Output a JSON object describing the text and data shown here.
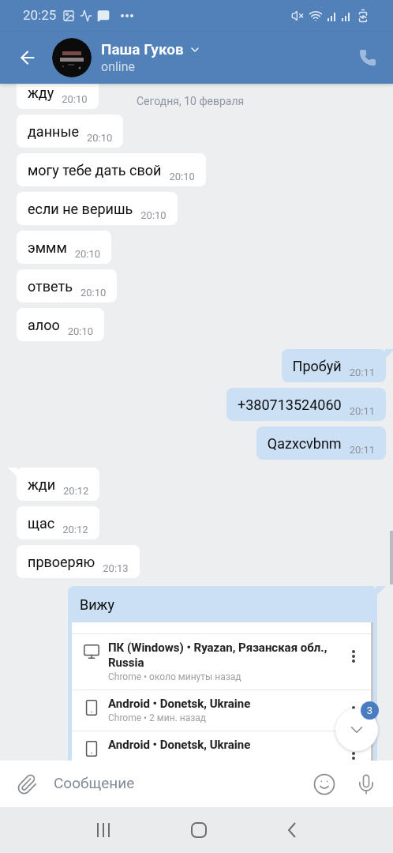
{
  "status_bar": {
    "time": "20:25"
  },
  "header": {
    "name": "Паша Гуков",
    "status": "online"
  },
  "date_label": "Сегодня, 10 февраля",
  "messages": [
    {
      "kind": "incoming",
      "text": "жду",
      "time": "20:10"
    },
    {
      "kind": "incoming",
      "text": "данные",
      "time": "20:10"
    },
    {
      "kind": "incoming",
      "text": "могу тебе дать свой",
      "time": "20:10"
    },
    {
      "kind": "incoming",
      "text": "если не веришь",
      "time": "20:10"
    },
    {
      "kind": "incoming",
      "text": "эммм",
      "time": "20:10"
    },
    {
      "kind": "incoming",
      "text": "ответь",
      "time": "20:10"
    },
    {
      "kind": "incoming",
      "text": "алоо",
      "time": "20:10"
    },
    {
      "kind": "outgoing",
      "text": "Пробуй",
      "time": "20:11"
    },
    {
      "kind": "outgoing",
      "text": "+380713524060",
      "time": "20:11"
    },
    {
      "kind": "outgoing",
      "text": "Qazxcvbnm",
      "time": "20:11"
    },
    {
      "kind": "incoming",
      "text": "жди",
      "time": "20:12"
    },
    {
      "kind": "incoming",
      "text": "щас",
      "time": "20:12"
    },
    {
      "kind": "incoming",
      "text": "првоеряю",
      "time": "20:13"
    }
  ],
  "attachment_message": {
    "text": "Вижу",
    "sessions": [
      {
        "kind": "desktop",
        "title": "ПК (Windows) • Ryazan, Рязанская обл., Russia",
        "subtitle": "Chrome • около минуты назад"
      },
      {
        "kind": "phone",
        "title": "Android • Donetsk, Ukraine",
        "subtitle": "Chrome • 2 мин. назад"
      },
      {
        "kind": "phone",
        "title": "Android • Donetsk, Ukraine"
      }
    ]
  },
  "scroll_button": {
    "badge": "3"
  },
  "composer": {
    "placeholder": "Сообщение"
  }
}
